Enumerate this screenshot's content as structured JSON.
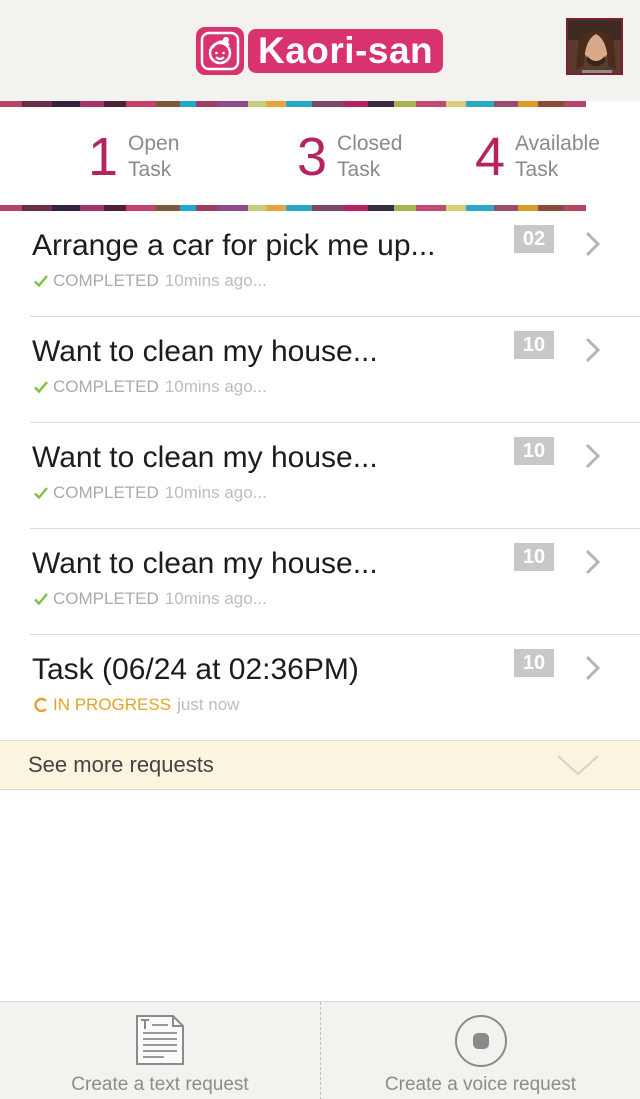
{
  "header": {
    "app_name": "Kaori-san",
    "logo_icon": "girl-face-icon",
    "avatar_icon": "user-avatar"
  },
  "stats": [
    {
      "count": "1",
      "line1": "Open",
      "line2": "Task"
    },
    {
      "count": "3",
      "line1": "Closed",
      "line2": "Task"
    },
    {
      "count": "4",
      "line1": "Available",
      "line2": "Task"
    }
  ],
  "tasks": [
    {
      "title": "Arrange a car for pick me up...",
      "status": "COMPLETED",
      "time": "10mins ago...",
      "count": "02"
    },
    {
      "title": "Want to clean my house...",
      "status": "COMPLETED",
      "time": "10mins ago...",
      "count": "10"
    },
    {
      "title": "Want to clean my house...",
      "status": "COMPLETED",
      "time": "10mins ago...",
      "count": "10"
    },
    {
      "title": "Want to clean my house...",
      "status": "COMPLETED",
      "time": "10mins ago...",
      "count": "10"
    },
    {
      "title": "Task (06/24 at 02:36PM)",
      "status": "IN PROGRESS",
      "time": "just now",
      "count": "10"
    }
  ],
  "see_more": {
    "label": "See more requests"
  },
  "bottom_bar": {
    "text_request_label": "Create a text request",
    "voice_request_label": "Create a voice request"
  },
  "colors": {
    "brand": "#d8336f",
    "stat_number": "#b5245f",
    "completed_check": "#7cc142",
    "in_progress": "#e2a52c",
    "badge": "#c8c8c8",
    "see_more_bg": "#fbf4de"
  }
}
